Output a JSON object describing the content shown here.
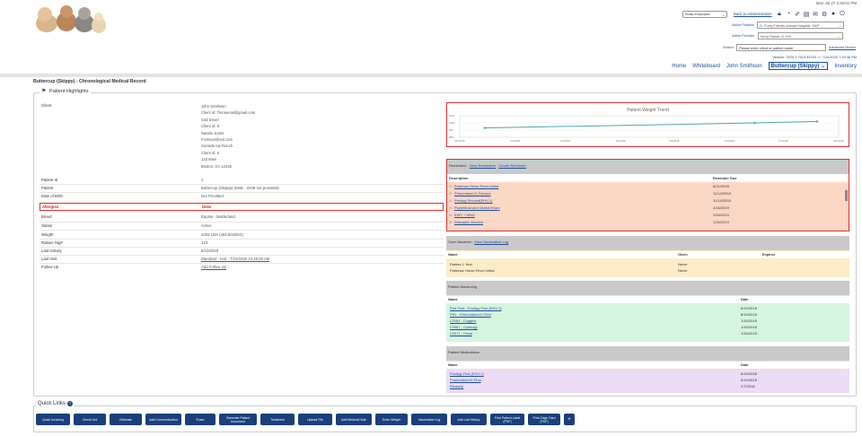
{
  "header": {
    "datetime": "Mon Jul 27 3:46:01 PM",
    "kiosk_value": "Kiosk-Employee",
    "back_to_admin": "Back to Administration",
    "active_practice_label": "Active Practice",
    "active_practice_value": "D. Furry Friends Animal Hospital: SAP",
    "active_provider_label": "Active Provider",
    "active_provider_value": "Harry Pause, D.V.M.",
    "search_label": "Search",
    "search_placeholder": "Please enter client or patient name",
    "advanced_search": "Advanced Search",
    "version": "Version: 2020.0.7510.34763 => 7/24/2020 7:19:46 PM",
    "nav": {
      "home": "Home",
      "whiteboard": "Whiteboard",
      "client": "John Smithson",
      "patient": "Buttercup (Skippy)",
      "inventory": "Inventory"
    }
  },
  "page_title": "Buttercup (Skippy) - Chronological Medical Record",
  "highlights": {
    "legend": "Patient Highlights",
    "client_label": "Client",
    "client_lines": [
      "John Smithson",
      "Client Id: Tlenserval@gmail.com",
      "Gail Deuel",
      "Client Id: 8",
      "Natalie Jones",
      "Foxhavn@aol.com",
      "Sunside-Up Ranch",
      "Client Id: 5",
      "123 Main",
      "Boston, GA 12345"
    ],
    "rows": [
      {
        "label": "Patient Id",
        "value": "1"
      },
      {
        "label": "Patient",
        "value": "Buttercup (Skippy) (Male - DOB not provided)"
      },
      {
        "label": "Date of Birth",
        "value": "Not Provided"
      },
      {
        "label": "Allergies",
        "value": "Dees"
      },
      {
        "label": "Breed",
        "value": "Equine - Belderland"
      },
      {
        "label": "Status",
        "value": "Active"
      },
      {
        "label": "Weight",
        "value": "1002 LBS (454.5042KG)"
      },
      {
        "label": "Rabies Tag#",
        "value": "123"
      },
      {
        "label": "Last Activity",
        "value": "8/12/2018"
      },
      {
        "label": "Last Visit",
        "value": "Standard - test - 7/24/2020 10:45:00 AM"
      },
      {
        "label": "Follow Up",
        "value": "Add Follow Up"
      }
    ]
  },
  "weight_chart": {
    "title": "Patient Weight Trend",
    "yticks": [
      "1010",
      "1000",
      "990",
      "980"
    ],
    "xticks": [
      "1/1/2018",
      "2/1/2018",
      "3/1/2018",
      "4/1/2018",
      "5/1/2018",
      "6/1/2018",
      "7/1/2018",
      "8/1/2018"
    ]
  },
  "chart_data": {
    "type": "line",
    "title": "Patient Weight Trend",
    "x": [
      "1/15/2018",
      "6/15/2018",
      "7/20/2018"
    ],
    "values": [
      993,
      1000,
      1002
    ],
    "ylim": [
      980,
      1010
    ]
  },
  "reminders": {
    "header": "Reminders -",
    "view_link": "View Reminders",
    "create_link": "Create Reminder",
    "col_desc": "Description",
    "col_due": "Reminder Due",
    "items": [
      {
        "desc": "Potomac Horse Fever Initial",
        "due": "8/21/2018"
      },
      {
        "desc": "Pneumabort-K Second",
        "due": "11/14/2018"
      },
      {
        "desc": "Prodigy Second(EHV-1)",
        "due": "11/14/2018"
      },
      {
        "desc": "Powerfloat and Dental Exam",
        "due": "1/16/2019"
      },
      {
        "desc": "EWT + WNV",
        "due": "1/16/2019"
      },
      {
        "desc": "Strangles Vaccine",
        "due": "1/16/2019"
      }
    ]
  },
  "vaccines": {
    "header": "Core Vaccines -",
    "view_link": "View Vaccination Log",
    "col_name": "Name",
    "col_given": "Given",
    "col_expires": "Expires",
    "items": [
      {
        "name": "Rabies 1 Year",
        "given": "Never",
        "expires": ""
      },
      {
        "name": "Potomac Horse Fever Initial",
        "given": "Never",
        "expires": ""
      }
    ]
  },
  "monitoring": {
    "header": "Patient Monitoring",
    "col_name": "Name",
    "col_date": "Date",
    "items": [
      {
        "name": "Port First - Prodigy First (EHV-1)",
        "date": "8/14/2018"
      },
      {
        "name": "PK1 - Pneumabort-K First",
        "date": "8/14/2018"
      },
      {
        "name": "L2064 - Coggins",
        "date": "1/16/2018"
      },
      {
        "name": "LS067 - Cytology",
        "date": "1/16/2018"
      },
      {
        "name": "LS017 - Fecal",
        "date": "1/16/2018"
      }
    ]
  },
  "medications": {
    "header": "Patient Medications",
    "col_name": "Name",
    "col_date": "Date",
    "items": [
      {
        "name": "Prodigy First (EHV-1)",
        "date": "8/14/2018"
      },
      {
        "name": "Pneumabort-K First",
        "date": "8/14/2018"
      },
      {
        "name": "Rivasoly",
        "date": "2/7/2018"
      }
    ]
  },
  "quick_links": {
    "legend": "Quick Links",
    "buttons": [
      "Quick Invoicing",
      "Check Out",
      "Estimate",
      "Add Communication",
      "Exam",
      "Generate Patient Document",
      "Treatment",
      "Upload File",
      "Add Medical Note",
      "Enter Weight",
      "Vaccination Log",
      "Add Lab History",
      "Print Patient Label (PDF)",
      "Print Cage Card (PDF)",
      "+"
    ]
  },
  "colors": {
    "accent_red": "#e03030",
    "button_navy": "#1a3f7c",
    "reminder_bg": "#fbd7c6",
    "vaccine_bg": "#fdecc8",
    "monitoring_bg": "#d6f5df",
    "medications_bg": "#ecdcf5"
  }
}
